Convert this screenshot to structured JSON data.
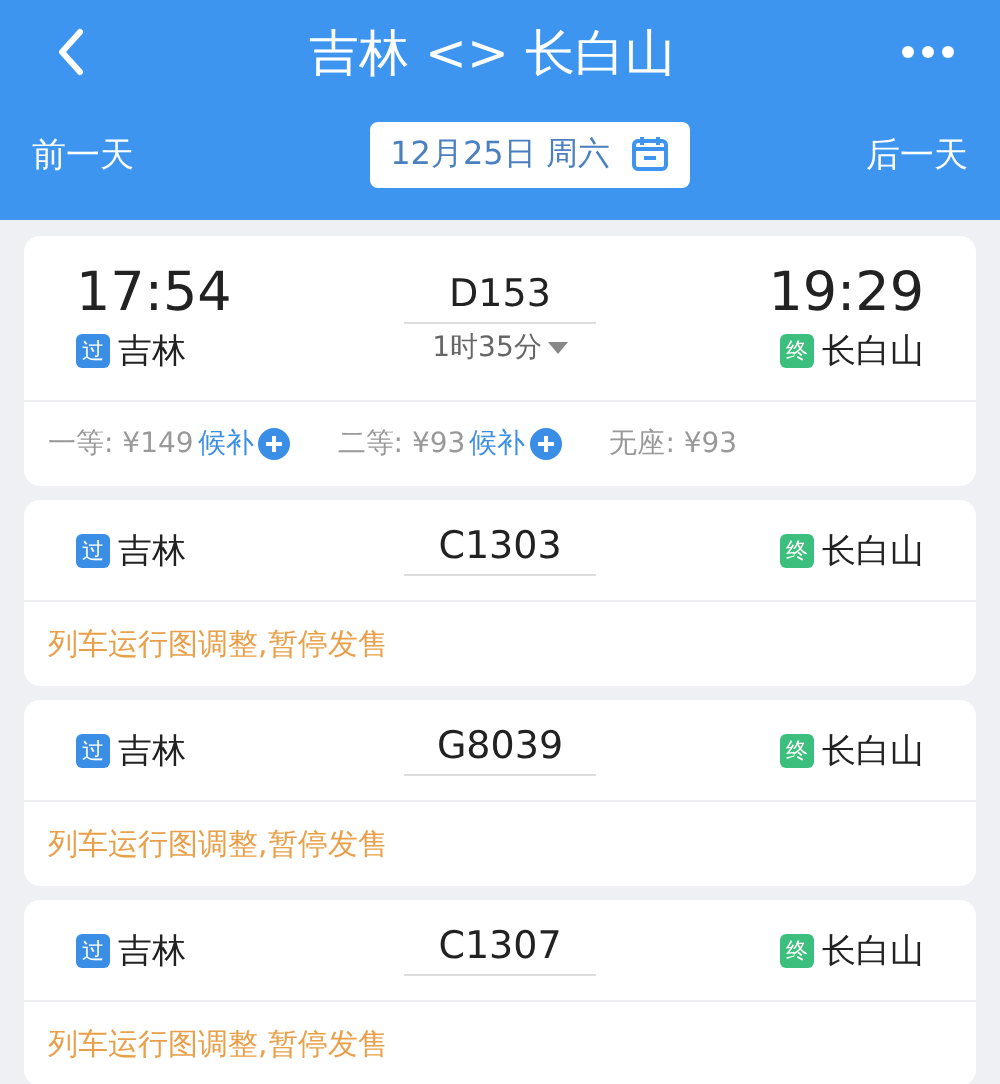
{
  "header": {
    "title": "吉林 <> 长白山",
    "prev_day": "前一天",
    "date": "12月25日 周六",
    "next_day": "后一天"
  },
  "trains": [
    {
      "kind": "available",
      "depart_time": "17:54",
      "from_badge": {
        "text": "过",
        "color": "#3a8ee6"
      },
      "from": "吉林",
      "number": "D153",
      "duration": "1时35分",
      "arrive_time": "19:29",
      "to_badge": {
        "text": "终",
        "color": "#3cbf7c"
      },
      "to": "长白山",
      "seats": [
        {
          "label": "一等: ¥149",
          "waitlist": "候补"
        },
        {
          "label": "二等: ¥93",
          "waitlist": "候补"
        },
        {
          "label": "无座: ¥93"
        }
      ]
    },
    {
      "kind": "suspended",
      "from_badge": {
        "text": "过",
        "color": "#3a8ee6"
      },
      "from": "吉林",
      "number": "C1303",
      "to_badge": {
        "text": "终",
        "color": "#3cbf7c"
      },
      "to": "长白山",
      "notice": "列车运行图调整,暂停发售"
    },
    {
      "kind": "suspended",
      "from_badge": {
        "text": "过",
        "color": "#3a8ee6"
      },
      "from": "吉林",
      "number": "G8039",
      "to_badge": {
        "text": "终",
        "color": "#3cbf7c"
      },
      "to": "长白山",
      "notice": "列车运行图调整,暂停发售"
    },
    {
      "kind": "suspended",
      "from_badge": {
        "text": "过",
        "color": "#3a8ee6"
      },
      "from": "吉林",
      "number": "C1307",
      "to_badge": {
        "text": "终",
        "color": "#3cbf7c"
      },
      "to": "长白山",
      "notice": "列车运行图调整,暂停发售"
    }
  ]
}
